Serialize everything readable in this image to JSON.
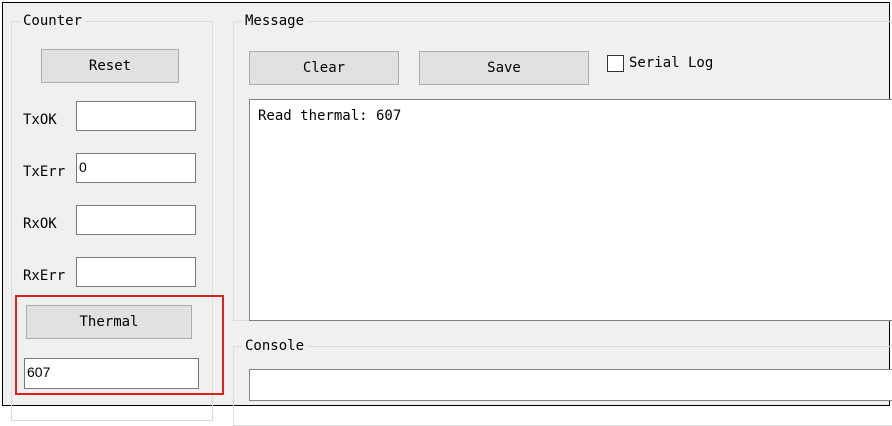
{
  "counter": {
    "legend": "Counter",
    "reset_label": "Reset",
    "fields": [
      {
        "label": "TxOK",
        "value": ""
      },
      {
        "label": "TxErr",
        "value": "0"
      },
      {
        "label": "RxOK",
        "value": ""
      },
      {
        "label": "RxErr",
        "value": ""
      }
    ],
    "thermal_label": "Thermal",
    "thermal_value": "607",
    "highlight_color": "#e02020"
  },
  "message": {
    "legend": "Message",
    "clear_label": "Clear",
    "save_label": "Save",
    "serial_log_label": "Serial Log",
    "serial_log_checked": false,
    "text": "Read thermal: 607"
  },
  "console": {
    "legend": "Console",
    "value": ""
  }
}
